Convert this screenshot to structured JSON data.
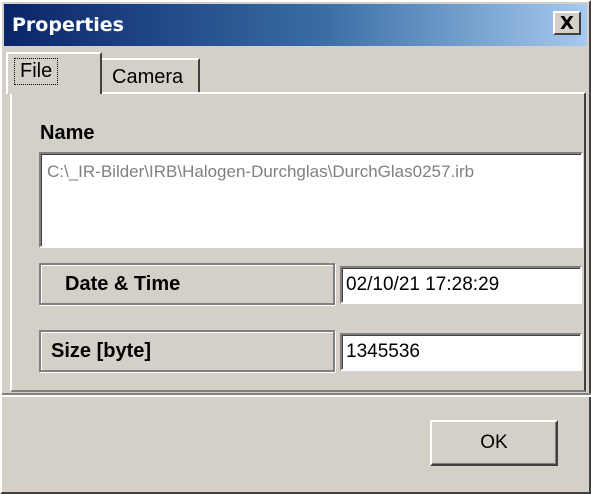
{
  "window": {
    "title": "Properties",
    "close_symbol": "X"
  },
  "tabs": [
    {
      "label": "File",
      "active": true
    },
    {
      "label": "Camera",
      "active": false
    }
  ],
  "file": {
    "name_label": "Name",
    "name_value": "C:\\_IR-Bilder\\IRB\\Halogen-Durchglas\\DurchGlas0257.irb",
    "datetime_label": "Date & Time",
    "datetime_value": "02/10/21 17:28:29",
    "size_label": "Size [byte]",
    "size_value": "1345536"
  },
  "buttons": {
    "ok_label": "OK"
  }
}
